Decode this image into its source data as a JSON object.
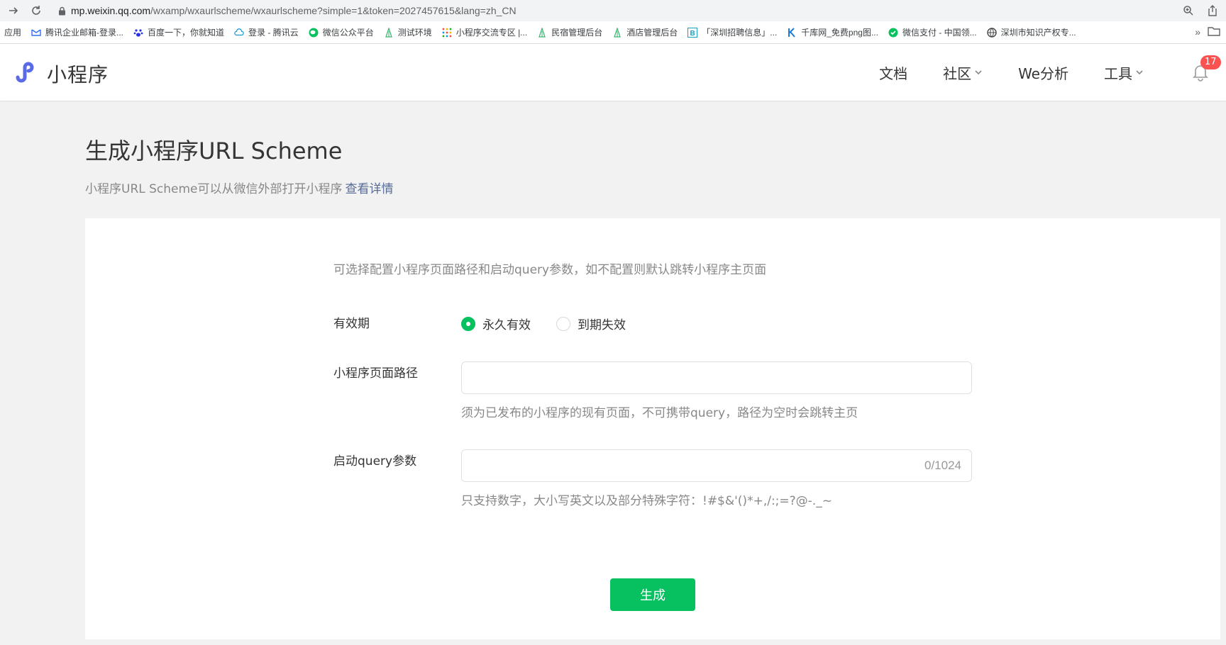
{
  "browser": {
    "url_host": "mp.weixin.qq.com",
    "url_path": "/wxamp/wxaurlscheme/wxaurlscheme?simple=1&token=2027457615&lang=zh_CN",
    "bookmarks": [
      {
        "label": "应用",
        "icon": "apps-icon"
      },
      {
        "label": "腾讯企业邮箱-登录...",
        "icon": "tencent-mail-icon",
        "color": "#2f6ef0"
      },
      {
        "label": "百度一下，你就知道",
        "icon": "baidu-paw-icon",
        "color": "#2932e1"
      },
      {
        "label": "登录 - 腾讯云",
        "icon": "tencent-cloud-icon",
        "color": "#1296db"
      },
      {
        "label": "微信公众平台",
        "icon": "wechat-icon",
        "color": "#07c160"
      },
      {
        "label": "测试环境",
        "icon": "tree-icon",
        "color": "#3cb371"
      },
      {
        "label": "小程序交流专区 |...",
        "icon": "dots-grid-icon",
        "color": "#e94b3c"
      },
      {
        "label": "民宿管理后台",
        "icon": "tree-icon",
        "color": "#3cb371"
      },
      {
        "label": "酒店管理后台",
        "icon": "tree-icon",
        "color": "#3cb371"
      },
      {
        "label": "「深圳招聘信息」...",
        "icon": "b-letter-icon",
        "color": "#1ba0c5"
      },
      {
        "label": "千库网_免费png图...",
        "icon": "k-letter-icon",
        "color": "#1a7bd9"
      },
      {
        "label": "微信支付 - 中国领...",
        "icon": "wechat-pay-icon",
        "color": "#07c160"
      },
      {
        "label": "深圳市知识产权专...",
        "icon": "globe-icon",
        "color": "#444444"
      }
    ],
    "more": "»"
  },
  "header": {
    "brand": "小程序",
    "nav": [
      {
        "label": "文档",
        "dropdown": false
      },
      {
        "label": "社区",
        "dropdown": true
      },
      {
        "label": "We分析",
        "dropdown": false
      },
      {
        "label": "工具",
        "dropdown": true
      }
    ],
    "notification_count": "17",
    "brand_color": "#5b6ae6"
  },
  "page": {
    "title": "生成小程序URL Scheme",
    "desc": "小程序URL Scheme可以从微信外部打开小程序",
    "desc_link": "查看详情"
  },
  "form": {
    "hint": "可选择配置小程序页面路径和启动query参数，如不配置则默认跳转小程序主页面",
    "validity": {
      "label": "有效期",
      "options": [
        {
          "label": "永久有效",
          "checked": true
        },
        {
          "label": "到期失效",
          "checked": false
        }
      ]
    },
    "path": {
      "label": "小程序页面路径",
      "value": "",
      "tip": "须为已发布的小程序的现有页面，不可携带query，路径为空时会跳转主页"
    },
    "query": {
      "label": "启动query参数",
      "value": "",
      "counter": "0/1024",
      "tip": "只支持数字，大小写英文以及部分特殊字符：!#$&'()*+,/:;=?@-._~"
    },
    "submit": "生成",
    "accent": "#07c160"
  }
}
